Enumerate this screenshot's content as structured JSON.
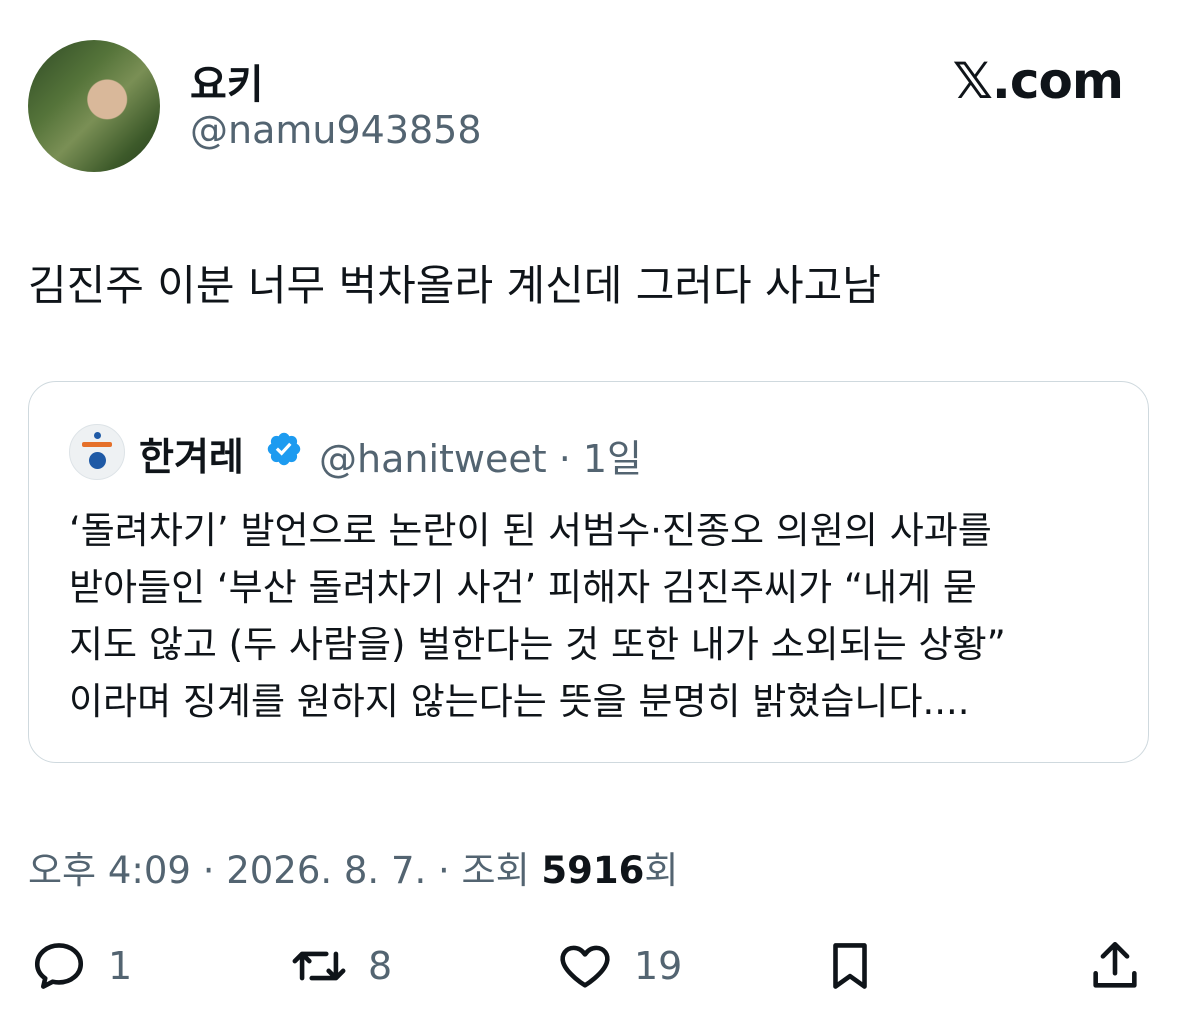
{
  "author": {
    "display_name": "요키",
    "handle": "@namu943858"
  },
  "brand": "𝕏.com",
  "tweet": {
    "text": "김진주 이분 너무 벅차올라 계신데 그러다 사고남"
  },
  "quote": {
    "name": "한겨레",
    "handle_time": "@hanitweet · 1일",
    "lines": [
      "‘돌려차기’ 발언으로 논란이 된 서범수·진종오 의원의 사과를",
      "받아들인 ‘부산 돌려차기 사건’ 피해자 김진주씨가 “내게 묻",
      "지도 않고 (두 사람을) 벌한다는 것 또한 내가 소외되는 상황”",
      "이라며 징계를 원하지 않는다는 뜻을 분명히 밝혔습니다...."
    ]
  },
  "meta": {
    "time_date": "오후 4:09 · 2026. 8. 7. · 조회 ",
    "views": "5916",
    "views_suffix": "회"
  },
  "actions": {
    "reply_count": "1",
    "retweet_count": "8",
    "like_count": "19"
  },
  "colors": {
    "text": "#0f1419",
    "secondary": "#536471",
    "border": "#cfd9de",
    "verified": "#1d9bf0"
  }
}
